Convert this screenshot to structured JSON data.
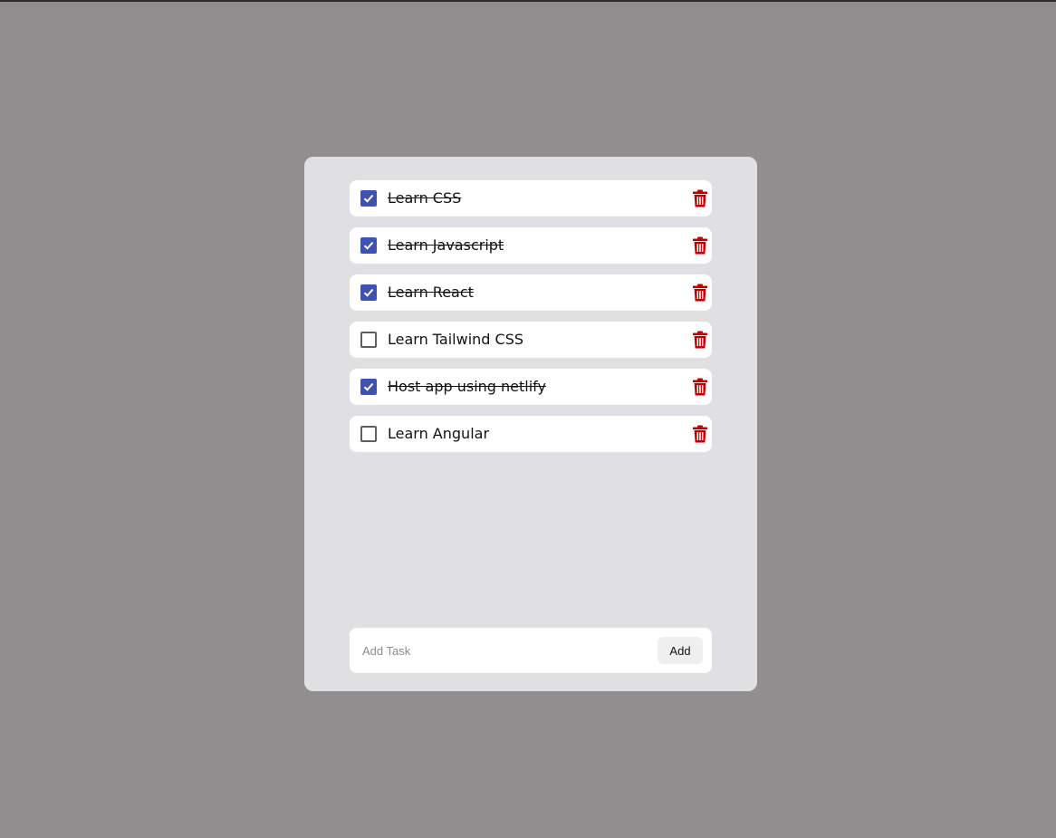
{
  "colors": {
    "background": "#908e8f",
    "panel": "#e0e0e2",
    "checkbox_checked": "#3f51b5",
    "delete_icon": "#c00000"
  },
  "tasks": [
    {
      "label": "Learn CSS",
      "completed": true,
      "delete_icon": "trash-icon"
    },
    {
      "label": "Learn Javascript",
      "completed": true,
      "delete_icon": "trash-icon"
    },
    {
      "label": "Learn React",
      "completed": true,
      "delete_icon": "trash-icon"
    },
    {
      "label": "Learn Tailwind CSS",
      "completed": false,
      "delete_icon": "trash-icon"
    },
    {
      "label": "Host app using netlify",
      "completed": true,
      "delete_icon": "trash-icon"
    },
    {
      "label": "Learn Angular",
      "completed": false,
      "delete_icon": "trash-icon"
    }
  ],
  "add_task": {
    "placeholder": "Add Task",
    "value": "",
    "button_label": "Add"
  }
}
